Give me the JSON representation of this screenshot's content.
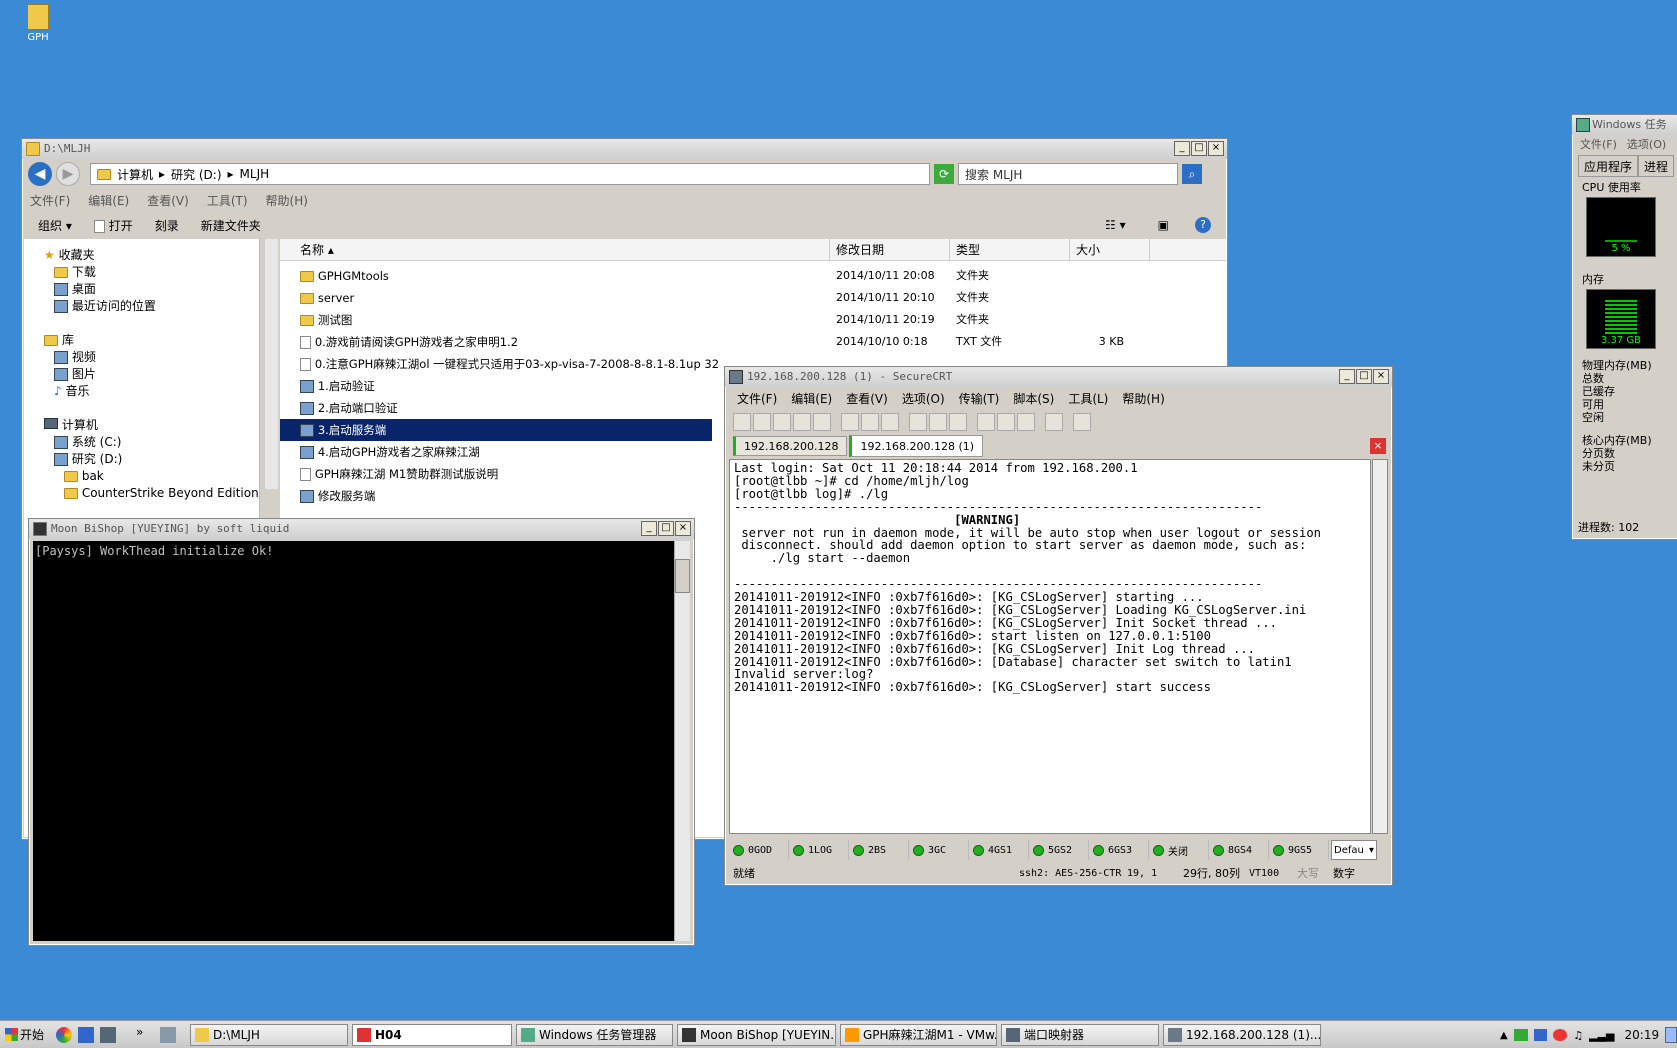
{
  "desktop": {
    "icon_label": "GPH"
  },
  "explorer": {
    "title": "D:\\MLJH",
    "breadcrumb": [
      "计算机",
      "研究 (D:)",
      "MLJH"
    ],
    "search_placeholder": "搜索 MLJH",
    "menu": [
      "文件(F)",
      "编辑(E)",
      "查看(V)",
      "工具(T)",
      "帮助(H)"
    ],
    "commands": [
      "组织",
      "打开",
      "刻录",
      "新建文件夹"
    ],
    "nav": {
      "favorites": "收藏夹",
      "favorites_items": [
        "下载",
        "桌面",
        "最近访问的位置"
      ],
      "libraries": "库",
      "libraries_items": [
        "视频",
        "图片",
        "音乐"
      ],
      "computer": "计算机",
      "computer_items": [
        "系统 (C:)",
        "研究 (D:)"
      ],
      "sub_items": [
        "bak",
        "CounterStrike Beyond Edition"
      ]
    },
    "columns": [
      "名称",
      "修改日期",
      "类型",
      "大小"
    ],
    "files": [
      {
        "name": "GPHGMtools",
        "date": "2014/10/11 20:08",
        "type": "文件夹",
        "size": "",
        "kind": "folder"
      },
      {
        "name": "server",
        "date": "2014/10/11 20:10",
        "type": "文件夹",
        "size": "",
        "kind": "folder"
      },
      {
        "name": "测试图",
        "date": "2014/10/11 20:19",
        "type": "文件夹",
        "size": "",
        "kind": "folder"
      },
      {
        "name": "0.游戏前请阅读GPH游戏者之家申明1.2",
        "date": "2014/10/10 0:18",
        "type": "TXT 文件",
        "size": "3 KB",
        "kind": "file"
      },
      {
        "name": "0.注意GPH麻辣江湖ol 一键程式只适用于03-xp-visa-7-2008-8-8.1-8.1up 32",
        "date": "",
        "type": "",
        "size": "",
        "kind": "file"
      },
      {
        "name": "1.启动验证",
        "date": "",
        "type": "",
        "size": "",
        "kind": "exe"
      },
      {
        "name": "2.启动端口验证",
        "date": "",
        "type": "",
        "size": "",
        "kind": "exe"
      },
      {
        "name": "3.启动服务端",
        "date": "",
        "type": "",
        "size": "",
        "kind": "exe"
      },
      {
        "name": "4.启动GPH游戏者之家麻辣江湖",
        "date": "",
        "type": "",
        "size": "",
        "kind": "exe"
      },
      {
        "name": "GPH麻辣江湖 M1赞助群测试版说明",
        "date": "",
        "type": "",
        "size": "",
        "kind": "file"
      },
      {
        "name": "修改服务端",
        "date": "",
        "type": "",
        "size": "",
        "kind": "exe"
      }
    ],
    "selected_index": 7
  },
  "console": {
    "title": "Moon BiShop [YUEYING] by soft liquid",
    "text": "[Paysys] WorkThead initialize Ok!"
  },
  "securecrt": {
    "title": "192.168.200.128 (1) - SecureCRT",
    "menu": [
      "文件(F)",
      "编辑(E)",
      "查看(V)",
      "选项(O)",
      "传输(T)",
      "脚本(S)",
      "工具(L)",
      "帮助(H)"
    ],
    "tabs": [
      "192.168.200.128",
      "192.168.200.128 (1)"
    ],
    "terminal_lines": [
      "Last login: Sat Oct 11 20:18:44 2014 from 192.168.200.1",
      "[root@tlbb ~]# cd /home/mljh/log",
      "[root@tlbb log]# ./lg",
      "------------------------------------------------------------------------",
      "                              [WARNING]",
      " server not run in daemon mode, it will be auto stop when user logout or session",
      " disconnect. should add daemon option to start server as daemon mode, such as:",
      "     ./lg start --daemon",
      "",
      "------------------------------------------------------------------------",
      "20141011-201912<INFO :0xb7f616d0>: [KG_CSLogServer] starting ...",
      "20141011-201912<INFO :0xb7f616d0>: [KG_CSLogServer] Loading KG_CSLogServer.ini",
      "20141011-201912<INFO :0xb7f616d0>: [KG_CSLogServer] Init Socket thread ...",
      "20141011-201912<INFO :0xb7f616d0>: start listen on 127.0.0.1:5100",
      "20141011-201912<INFO :0xb7f616d0>: [KG_CSLogServer] Init Log thread ...",
      "20141011-201912<INFO :0xb7f616d0>: [Database] character set switch to latin1",
      "Invalid server:log?",
      "20141011-201912<INFO :0xb7f616d0>: [KG_CSLogServer] start success"
    ],
    "buttons": [
      "0GOD",
      "1LOG",
      "2BS",
      "3GC",
      "4GS1",
      "5GS2",
      "6GS3",
      "关闭",
      "8GS4",
      "9GS5"
    ],
    "default_select": "Defau",
    "status": {
      "ready": "就绪",
      "cipher": "ssh2: AES-256-CTR",
      "pos": "19,   1",
      "rows_cols": "29行, 80列",
      "term": "VT100",
      "caps": "大写",
      "num": "数字"
    }
  },
  "taskmgr": {
    "title": "Windows 任务",
    "menu": [
      "文件(F)",
      "选项(O)"
    ],
    "tabs": [
      "应用程序",
      "进程"
    ],
    "cpu_label": "CPU 使用率",
    "cpu_value": "5 %",
    "cpu_percent": 5,
    "mem_label": "内存",
    "mem_value": "3.37 GB",
    "phys_label": "物理内存(MB)",
    "phys_items": [
      "总数",
      "已缓存",
      "可用",
      "空闲"
    ],
    "kernel_label": "核心内存(MB)",
    "kernel_items": [
      "分页数",
      "未分页"
    ],
    "processes": "进程数: 102"
  },
  "taskbar": {
    "start": "开始",
    "tasks": [
      "D:\\MLJH",
      "H04",
      "Windows 任务管理器",
      "Moon BiShop [YUEYIN...",
      "GPH麻辣江湖M1 - VMw...",
      "端口映射器",
      "192.168.200.128 (1)..."
    ],
    "clock": "20:19"
  }
}
